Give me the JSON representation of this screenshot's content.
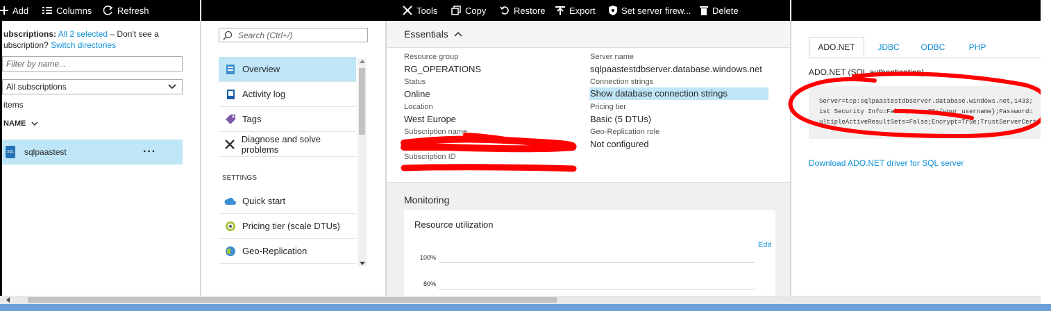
{
  "toolbar_left": {
    "add": "Add",
    "columns": "Columns",
    "refresh": "Refresh"
  },
  "toolbar_main": {
    "tools": "Tools",
    "copy": "Copy",
    "restore": "Restore",
    "export": "Export",
    "firewall": "Set server firew...",
    "delete": "Delete"
  },
  "resource_list": {
    "subs_label": "ubscriptions:",
    "subs_link": "All 2 selected",
    "subs_text": "– Don't see a",
    "subs_line2": "ubscription?",
    "switch_link": "Switch directories",
    "filter_placeholder": "Filter by name...",
    "subscription_select": "All subscriptions",
    "items_count": "items",
    "column_header": "NAME",
    "items": [
      {
        "name": "sqlpaastest",
        "icon_text": "SQL",
        "more": "···"
      }
    ]
  },
  "blade_menu": {
    "search_placeholder": "Search (Ctrl+/)",
    "items": [
      {
        "label": "Overview",
        "icon": "overview-icon"
      },
      {
        "label": "Activity log",
        "icon": "activity-log-icon"
      },
      {
        "label": "Tags",
        "icon": "tag-icon"
      },
      {
        "label": "Diagnose and solve problems",
        "icon": "wrench-icon"
      }
    ],
    "settings_header": "SETTINGS",
    "settings_items": [
      {
        "label": "Quick start",
        "icon": "cloud-icon"
      },
      {
        "label": "Pricing tier (scale DTUs)",
        "icon": "pricing-icon"
      },
      {
        "label": "Geo-Replication",
        "icon": "globe-icon"
      }
    ]
  },
  "essentials": {
    "title": "Essentials",
    "resource_group_label": "Resource group",
    "resource_group_value": "RG_OPERATIONS",
    "status_label": "Status",
    "status_value": "Online",
    "location_label": "Location",
    "location_value": "West Europe",
    "subscription_name_label": "Subscription name",
    "subscription_id_label": "Subscription ID",
    "server_name_label": "Server name",
    "server_name_value": "sqlpaastestdbserver.database.windows.net",
    "conn_label": "Connection strings",
    "conn_value": "Show database connection strings",
    "pricing_label": "Pricing tier",
    "pricing_value": "Basic (5 DTUs)",
    "geo_label": "Geo-Replication role",
    "geo_value": "Not configured"
  },
  "monitoring": {
    "title": "Monitoring",
    "card_title": "Resource utilization",
    "edit": "Edit",
    "ticks": [
      "100%",
      "80%"
    ]
  },
  "connection_blade": {
    "tabs": [
      "ADO.NET",
      "JDBC",
      "ODBC",
      "PHP"
    ],
    "active_tab": "ADO.NET",
    "heading": "ADO.NET (SQL authentication)",
    "code_line1": "Server=tcp:sqlpaastestdbserver.database.windows.net,1433;",
    "code_line2": "ist Security Info=False;User ID={your_username};Password=",
    "code_line3": "ultipleActiveResultSets=False;Encrypt=True;TrustServerCertificate=False",
    "download_link": "Download ADO.NET driver for SQL server"
  },
  "colors": {
    "accent": "#0f8fd6",
    "selected": "#bfe6f7",
    "redaction": "#ff0000"
  }
}
